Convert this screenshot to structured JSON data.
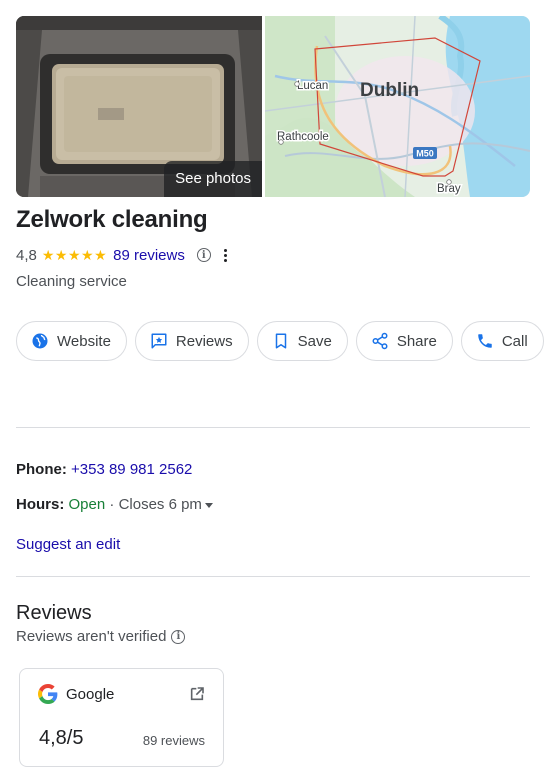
{
  "photos": {
    "see_photos_label": "See photos"
  },
  "map": {
    "labels": {
      "city": "Dublin",
      "lucan": "Lucan",
      "rathcoole": "Rathcoole",
      "bray": "Bray",
      "motorway": "M50"
    }
  },
  "business": {
    "name": "Zelwork cleaning",
    "rating": "4,8",
    "stars": "★★★★★",
    "reviews_label": "89 reviews",
    "category": "Cleaning service"
  },
  "actions": [
    {
      "label": "Website",
      "icon": "globe-icon"
    },
    {
      "label": "Reviews",
      "icon": "review-star-icon"
    },
    {
      "label": "Save",
      "icon": "bookmark-icon"
    },
    {
      "label": "Share",
      "icon": "share-icon"
    },
    {
      "label": "Call",
      "icon": "phone-icon"
    }
  ],
  "details": {
    "phone_label": "Phone:",
    "phone_value": "+353 89 981 2562",
    "hours_label": "Hours:",
    "hours_status": "Open",
    "hours_separator": " · ",
    "hours_closes": "Closes 6 pm",
    "suggest_edit": "Suggest an edit"
  },
  "reviews_section": {
    "heading": "Reviews",
    "note": "Reviews aren't verified",
    "card": {
      "source": "Google",
      "score": "4,8/5",
      "count": "89 reviews"
    }
  },
  "colors": {
    "link": "#1a0dab",
    "open": "#188038",
    "star": "#fbbc04",
    "accent_icon": "#1a73e8"
  }
}
